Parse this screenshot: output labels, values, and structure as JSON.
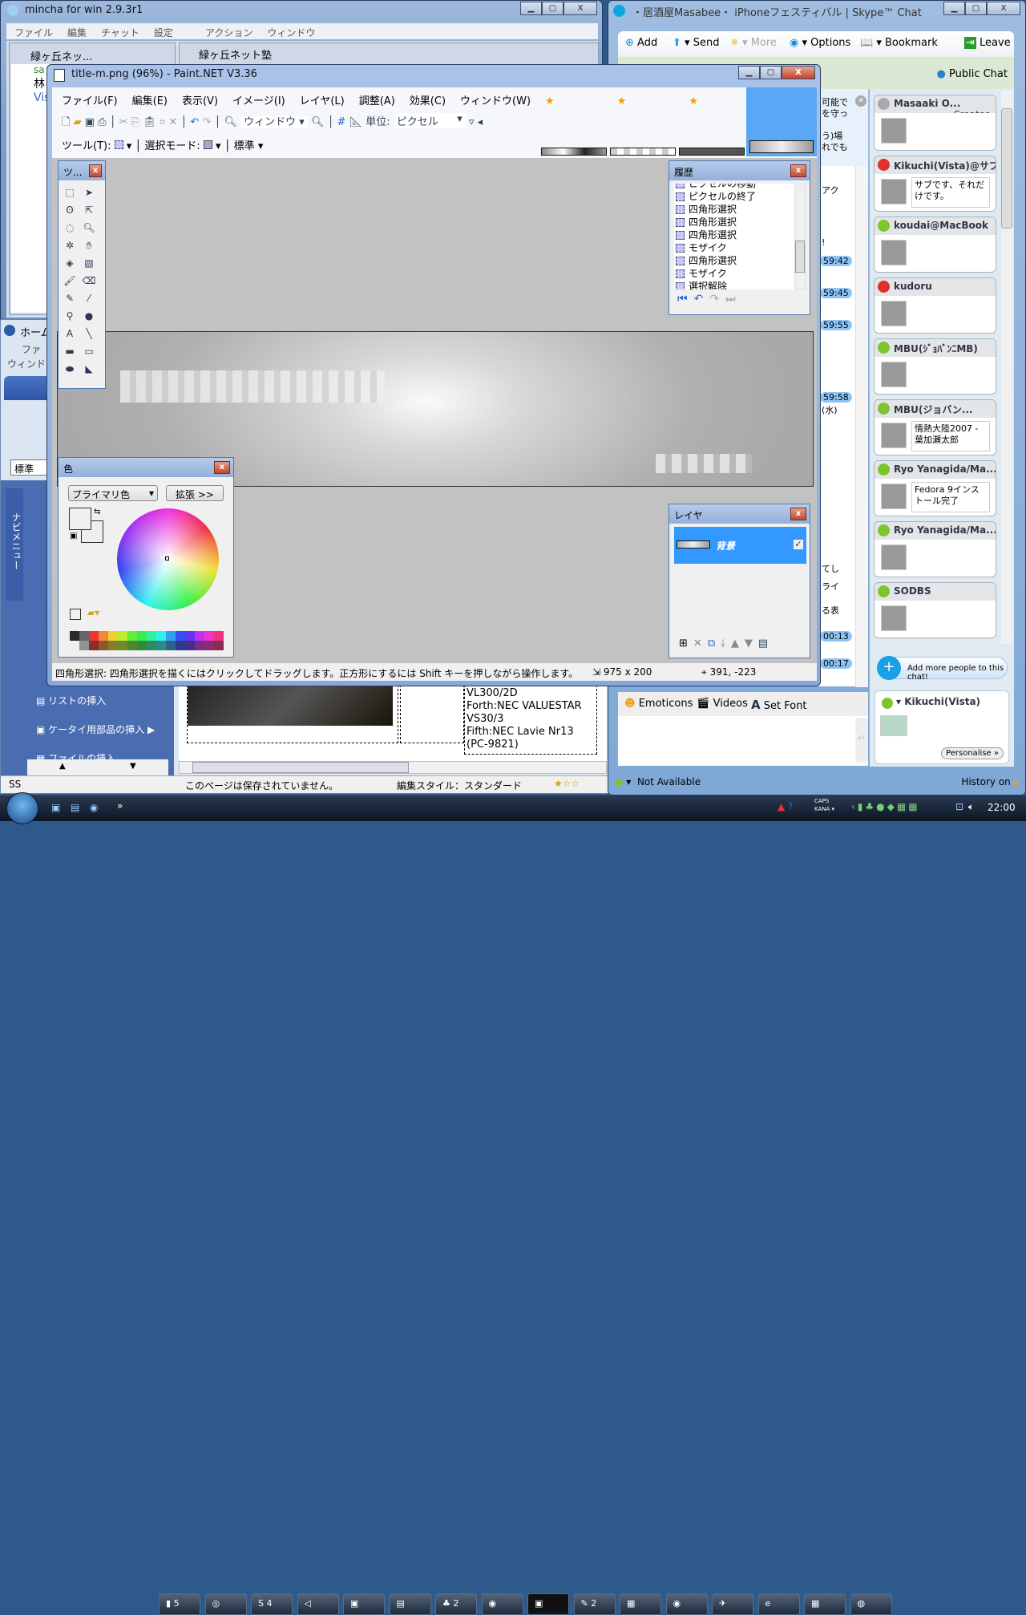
{
  "mincha": {
    "title": "mincha for win 2.9.3r1",
    "menu": [
      "ファイル",
      "編集",
      "チャット",
      "設定",
      "アクション",
      "ウィンドウ"
    ],
    "child1_title": "緑ヶ丘ネッ...",
    "child2_title": "緑ヶ丘ネット塾",
    "list": [
      "sa",
      "林",
      "Vis"
    ]
  },
  "homepage": {
    "title": "ホーム",
    "menu": [
      "ファ",
      "ウィンド"
    ],
    "style_select": "標準",
    "nav_tab": "ナビメニュー",
    "side_items": [
      "リストの挿入",
      "ケータイ用部品の挿入",
      "ファイルの挿入"
    ],
    "table_text": [
      "VL300/2D",
      "Forth:NEC VALUESTAR",
      "VS30/3",
      "Fifth:NEC Lavie Nr13",
      "(PC-9821)"
    ],
    "status": [
      "SS",
      "このページは保存されていません。",
      "編集スタイル：スタンダード"
    ]
  },
  "skype": {
    "title": "・居酒屋Masabee・ iPhoneフェスティバル | Skype™ Chat",
    "toolbar": {
      "add": "Add",
      "send": "Send",
      "more": "More",
      "options": "Options",
      "bookmark": "Bookmark",
      "leave": "Leave"
    },
    "public_chat": "Public Chat",
    "chat_fragments": [
      "可能で",
      "を守っ",
      "う)場",
      "れでも",
      "アク",
      "!",
      "59:42",
      "59:45",
      "59:55",
      "59:58",
      "(水)",
      "てし",
      "ライ",
      "る表",
      "00:13",
      "00:17"
    ],
    "participants": [
      {
        "name": "Masaaki O...",
        "role": "Creator",
        "status": "offline",
        "mood": ""
      },
      {
        "name": "Kikuchi(Vista)@サブ",
        "status": "dnd",
        "mood": "サブです、それだけです。"
      },
      {
        "name": "koudai@MacBook",
        "status": "online",
        "mood": ""
      },
      {
        "name": "kudoru",
        "status": "dnd",
        "mood": ""
      },
      {
        "name": "MBU(ｼﾞｮﾊﾞﾝﾆMB)",
        "status": "away",
        "mood": ""
      },
      {
        "name": "MBU(ジョバン...",
        "status": "online",
        "mood": "情熱大陸2007 - 葉加瀬太郎"
      },
      {
        "name": "Ryo Yanagida/Ma...",
        "status": "online",
        "mood": "Fedora 9インストール完了"
      },
      {
        "name": "Ryo Yanagida/Ma...",
        "status": "na",
        "mood": ""
      },
      {
        "name": "SODBS",
        "status": "online",
        "mood": ""
      }
    ],
    "add_people": "Add more people to this chat!",
    "me": {
      "name": "Kikuchi(Vista)",
      "personalise": "Personalise »"
    },
    "input_tools": {
      "emoticons": "Emoticons",
      "videos": "Videos",
      "set_font": "Set Font"
    },
    "status_text": "Not Available",
    "history": "History on"
  },
  "paint": {
    "title": "title-m.png (96%) - Paint.NET V3.36",
    "menu": [
      "ファイル(F)",
      "編集(E)",
      "表示(V)",
      "イメージ(I)",
      "レイヤ(L)",
      "調整(A)",
      "効果(C)",
      "ウィンドウ(W)"
    ],
    "zoom_select": "ウィンドウ",
    "unit_label": "単位:",
    "unit_select": "ピクセル",
    "tool_label": "ツール(T):",
    "select_mode_label": "選択モード:",
    "quality": "標準",
    "tools_title": "ツ...",
    "history_title": "履歴",
    "history_items": [
      "ピクセルの移動",
      "ピクセルの終了",
      "四角形選択",
      "四角形選択",
      "四角形選択",
      "モザイク",
      "四角形選択",
      "モザイク",
      "選択解除"
    ],
    "colors_title": "色",
    "color_mode": "プライマリ色",
    "expand": "拡張 >>",
    "palette_top": [
      "#2b2b2b",
      "#656565",
      "#ef3333",
      "#ef8a33",
      "#efcf33",
      "#b9ef33",
      "#5fef33",
      "#33ef4f",
      "#33efa0",
      "#33efef",
      "#339fef",
      "#334fef",
      "#6633ef",
      "#bf33ef",
      "#ef33cf",
      "#ef3380"
    ],
    "palette_bottom": [
      "#efefef",
      "#939393",
      "#8a2d2d",
      "#8a5a2d",
      "#8a7a2d",
      "#6f8a2d",
      "#4a8a2d",
      "#2d8a3a",
      "#2d8a68",
      "#2d8a8a",
      "#2d638a",
      "#2d3a8a",
      "#4a2d8a",
      "#782d8a",
      "#8a2d78",
      "#8a2d50"
    ],
    "layers_title": "レイヤ",
    "layer_name": "背景",
    "layer_visible": true,
    "status": "四角形選択: 四角形選択を描くにはクリックしてドラッグします。正方形にするには Shift キーを押しながら操作します。",
    "image_size": "975 x 200",
    "cursor_pos": "391, -223"
  },
  "taskbar": {
    "buttons": [
      "5",
      "",
      "4",
      "",
      "",
      "",
      "2",
      "",
      "",
      "2",
      "",
      "",
      "",
      "",
      "",
      ""
    ],
    "ime": [
      "CAPS",
      "KANA"
    ],
    "clock": "22:00"
  }
}
